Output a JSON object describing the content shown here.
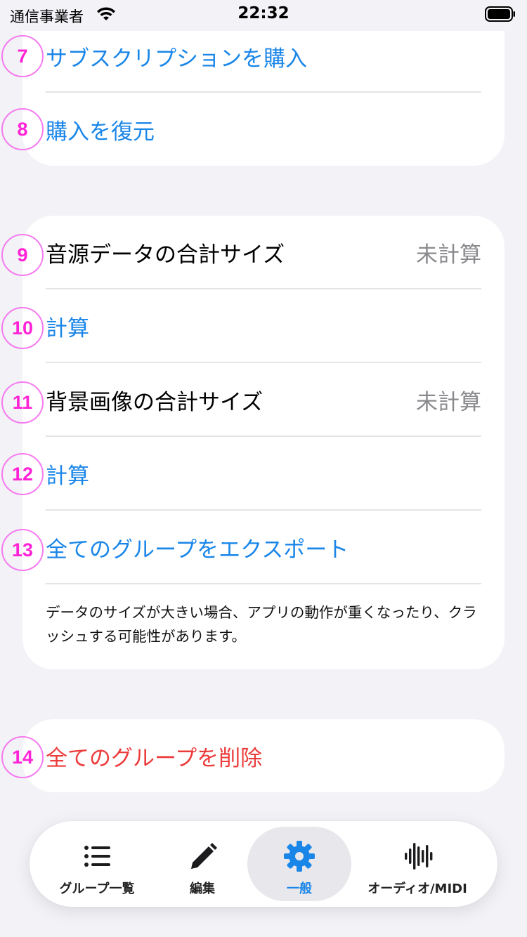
{
  "status_bar": {
    "carrier": "通信事業者",
    "time": "22:32"
  },
  "purchase_section": {
    "rows": [
      {
        "badge": "7",
        "label": "サブスクリプションを購入"
      },
      {
        "badge": "8",
        "label": "購入を復元"
      }
    ]
  },
  "data_section": {
    "rows": [
      {
        "badge": "9",
        "label": "音源データの合計サイズ",
        "value": "未計算"
      },
      {
        "badge": "10",
        "label": "計算"
      },
      {
        "badge": "11",
        "label": "背景画像の合計サイズ",
        "value": "未計算"
      },
      {
        "badge": "12",
        "label": "計算"
      },
      {
        "badge": "13",
        "label": "全てのグループをエクスポート"
      }
    ],
    "note": "データのサイズが大きい場合、アプリの動作が重くなったり、クラッシュする可能性があります。"
  },
  "danger_section": {
    "rows": [
      {
        "badge": "14",
        "label": "全てのグループを削除"
      }
    ]
  },
  "tab_bar": {
    "tabs": [
      {
        "label": "グループ一覧",
        "icon": "list-icon"
      },
      {
        "label": "編集",
        "icon": "pencil-icon"
      },
      {
        "label": "一般",
        "icon": "gear-icon",
        "active": true
      },
      {
        "label": "オーディオ/MIDI",
        "icon": "waveform-icon"
      }
    ]
  },
  "colors": {
    "accent": "#1a86e8",
    "destructive": "#ec3b3b",
    "badge": "#ff22d6",
    "background": "#f2f2f7"
  }
}
